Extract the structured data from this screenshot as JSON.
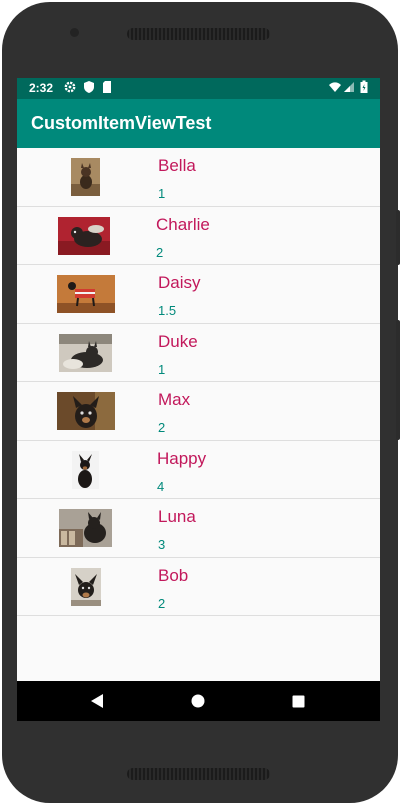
{
  "statusbar": {
    "time": "2:32"
  },
  "appbar": {
    "title": "CustomItemViewTest"
  },
  "dogs": [
    {
      "name": "Bella",
      "count": "1"
    },
    {
      "name": "Charlie",
      "count": "2"
    },
    {
      "name": "Daisy",
      "count": "1.5"
    },
    {
      "name": "Duke",
      "count": "1"
    },
    {
      "name": "Max",
      "count": "2"
    },
    {
      "name": "Happy",
      "count": "4"
    },
    {
      "name": "Luna",
      "count": "3"
    },
    {
      "name": "Bob",
      "count": "2"
    }
  ],
  "icons": {
    "status_left": [
      "gear-icon",
      "shield-icon",
      "sd-card-icon"
    ],
    "status_right": [
      "wifi-icon",
      "cell-signal-icon",
      "battery-icon"
    ],
    "nav": [
      "back-icon",
      "home-icon",
      "recents-icon"
    ]
  },
  "colors": {
    "status_bar": "#00695c",
    "app_bar": "#00897b",
    "name_text": "#c2185b",
    "count_text": "#00897b"
  }
}
